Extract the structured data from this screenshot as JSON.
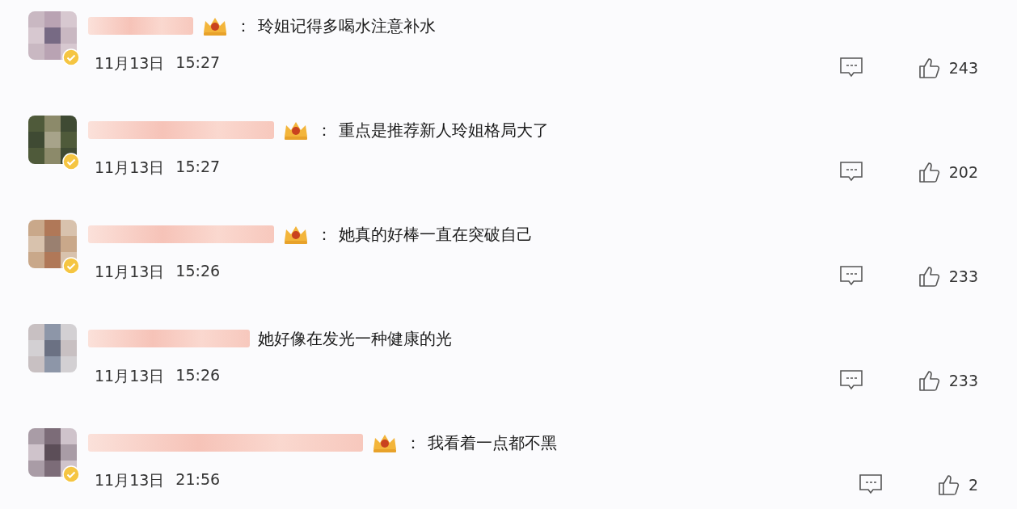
{
  "comments": [
    {
      "vip": true,
      "separator": "：",
      "text": "玲姐记得多喝水注意补水",
      "verified": true,
      "date": "11月13日",
      "time": "15:27",
      "likes": "243"
    },
    {
      "vip": true,
      "separator": "：",
      "text": "重点是推荐新人玲姐格局大了",
      "verified": true,
      "date": "11月13日",
      "time": "15:27",
      "likes": "202"
    },
    {
      "vip": true,
      "separator": "：",
      "text": "她真的好棒一直在突破自己",
      "verified": true,
      "date": "11月13日",
      "time": "15:26",
      "likes": "233"
    },
    {
      "vip": false,
      "text": "她好像在发光一种健康的光",
      "verified": false,
      "date": "11月13日",
      "time": "15:26",
      "likes": "233"
    },
    {
      "vip": true,
      "separator": "：",
      "text": "我看着一点都不黑",
      "verified": true,
      "date": "11月13日",
      "time": "21:56",
      "likes": "2"
    }
  ]
}
